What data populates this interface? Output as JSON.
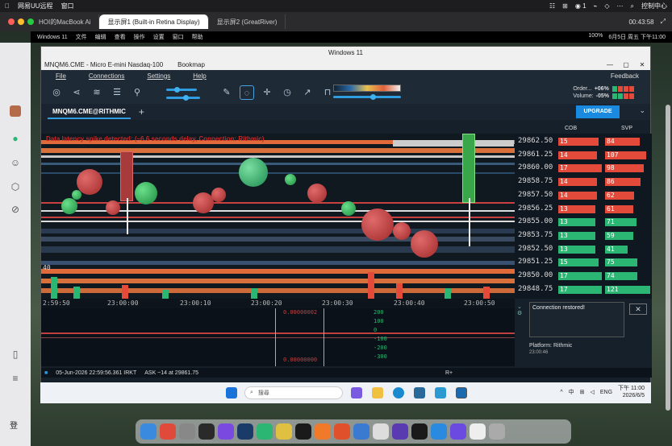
{
  "mac_menubar": {
    "app": "网易UU远程",
    "menu": "窗口",
    "right_items": [
      "☷",
      "⊞",
      "◉ 1",
      "⌁",
      "◇",
      "⋯",
      "⌕",
      "控制中心"
    ]
  },
  "mac_tabs": {
    "tabs": [
      {
        "label": "HOI的MacBook Ai",
        "active": false
      },
      {
        "label": "显示屏1 (Built-in Retina Display)",
        "active": true
      },
      {
        "label": "显示屏2 (GreatRiver)",
        "active": false
      }
    ],
    "timer": "00:43:58"
  },
  "win_topbar": {
    "items": [
      "Windows 11",
      "文件",
      "编辑",
      "查看",
      "操作",
      "设置",
      "窗口",
      "帮助"
    ],
    "right_items": [
      "100%",
      "6月5日 周五 下午11:00"
    ]
  },
  "bookmap": {
    "window_title": "Windows 11",
    "app_title": "MNQM6.CME - Micro E-mini Nasdaq-100",
    "app_name": "Bookmap",
    "menu": [
      "File",
      "Connections",
      "Settings",
      "Help"
    ],
    "feedback": "Feedback",
    "order_label": "Order...",
    "order_value": "+06%",
    "volume_label": "Volume:",
    "volume_value": "-05%",
    "tab_label": "MNQM6.CME@RITHMIC",
    "upgrade_label": "UPGRADE",
    "alert_text": "Data latency spike detected: (~6.6 seconds delay, Connection: Rithmic)",
    "cob_header": "COB",
    "svp_header": "SVP",
    "price_rows": [
      {
        "price": "29862.50",
        "cob": "15",
        "svp": "84",
        "cob_color": "#e34a3a"
      },
      {
        "price": "29861.25",
        "cob": "14",
        "svp": "107",
        "cob_color": "#e34a3a"
      },
      {
        "price": "29860.00",
        "cob": "17",
        "svp": "98",
        "cob_color": "#e34a3a"
      },
      {
        "price": "29858.75",
        "cob": "14",
        "svp": "86",
        "cob_color": "#e34a3a"
      },
      {
        "price": "29857.50",
        "cob": "14",
        "svp": "62",
        "cob_color": "#e34a3a"
      },
      {
        "price": "29856.25",
        "cob": "13",
        "svp": "61",
        "cob_color": "#e34a3a"
      },
      {
        "price": "29855.00",
        "cob": "13",
        "svp": "71",
        "cob_color": "#2bb673"
      },
      {
        "price": "29853.75",
        "cob": "13",
        "svp": "59",
        "cob_color": "#2bb673"
      },
      {
        "price": "29852.50",
        "cob": "13",
        "svp": "41",
        "cob_color": "#2bb673"
      },
      {
        "price": "29851.25",
        "cob": "15",
        "svp": "75",
        "cob_color": "#2bb673"
      },
      {
        "price": "29850.00",
        "cob": "17",
        "svp": "74",
        "cob_color": "#2bb673"
      },
      {
        "price": "29848.75",
        "cob": "17",
        "svp": "121",
        "cob_color": "#2bb673"
      }
    ],
    "time_ticks": [
      "2:59:50",
      "23:00:00",
      "23:00:10",
      "23:00:20",
      "23:00:30",
      "23:00:40",
      "23:00:50"
    ],
    "volume_label_left": "40",
    "indicator": {
      "top_value": "0.00000002",
      "bottom_value": "0.00000000",
      "scale": [
        "200",
        "100",
        "0",
        "-100",
        "-200",
        "-300"
      ]
    },
    "toast_title": "Connection restored!",
    "platform": "Platform: Rithmic",
    "platform_time": "23:00:46",
    "status_date": "05-Jun-2026 22:59:56.361 IRKT",
    "status_ask": "ASK ~14 at 29861.75",
    "status_r": "R+"
  },
  "taskbar": {
    "search": "搜尋",
    "tray": [
      "^",
      "中",
      "⊞",
      "◁",
      "ENG"
    ],
    "time": "下午 11:00",
    "date": "2026/6/5"
  },
  "bottom_cut_text": "登",
  "colors": {
    "accent": "#2f9de0",
    "bid": "#2bb673",
    "ask": "#e34a3a"
  }
}
